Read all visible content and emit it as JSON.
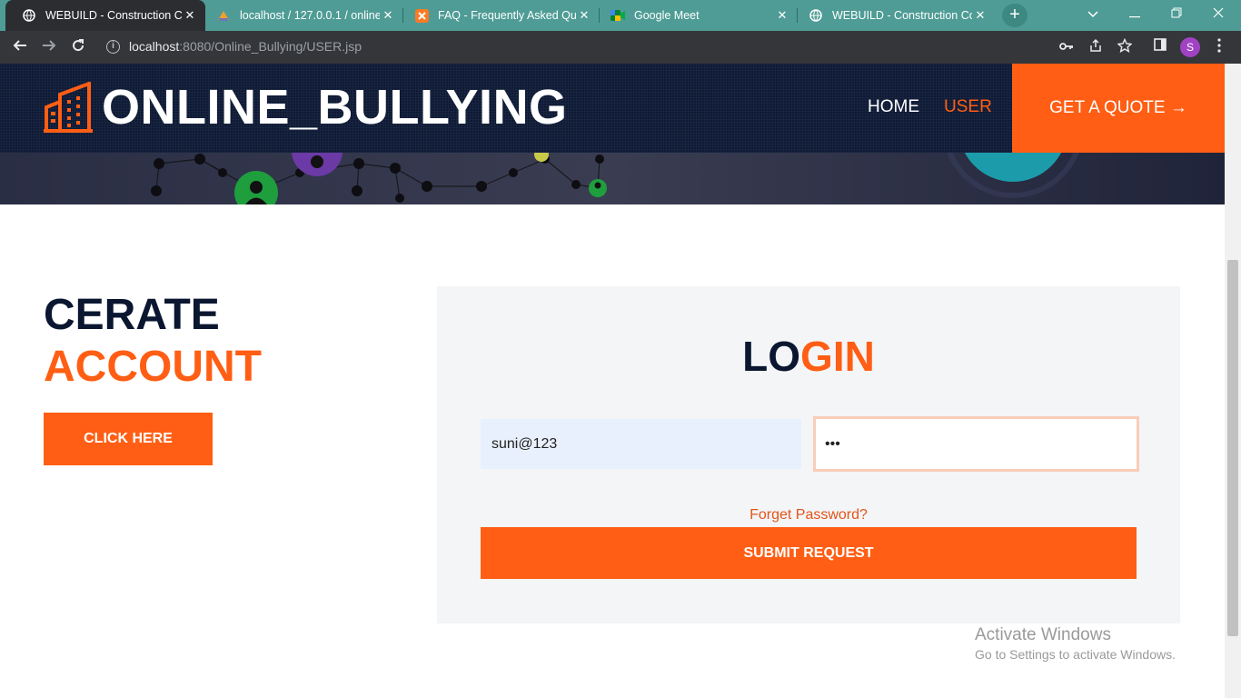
{
  "browser": {
    "tabs": [
      {
        "title": "WEBUILD - Construction Com",
        "active": true,
        "icon": "globe-icon"
      },
      {
        "title": "localhost / 127.0.0.1 / online",
        "active": false,
        "icon": "phpmyadmin-icon"
      },
      {
        "title": "FAQ - Frequently Asked Que",
        "active": false,
        "icon": "xampp-icon"
      },
      {
        "title": "Google Meet",
        "active": false,
        "icon": "google-meet-icon"
      },
      {
        "title": "WEBUILD - Construction Com",
        "active": false,
        "icon": "globe-icon"
      }
    ],
    "close_glyph": "✕",
    "new_tab_glyph": "+",
    "url_host": "localhost",
    "url_rest": ":8080/Online_Bullying/USER.jsp",
    "avatar_letter": "S"
  },
  "site": {
    "brand": "ONLINE_BULLYING",
    "nav": {
      "home": "HOME",
      "user": "USER"
    },
    "quote_button": "GET A QUOTE →",
    "accent_color": "#ff5e14",
    "dark_color": "#0b1730"
  },
  "create": {
    "line1": "CERATE",
    "line2": "ACCOUNT",
    "button": "CLICK HERE"
  },
  "login": {
    "title_part1": "LO",
    "title_part2": "GIN",
    "username_value": "suni@123",
    "password_value": "•••",
    "forget_link": "Forget Password?",
    "submit": "SUBMIT REQUEST"
  },
  "watermark": {
    "line1": "Activate Windows",
    "line2": "Go to Settings to activate Windows."
  }
}
